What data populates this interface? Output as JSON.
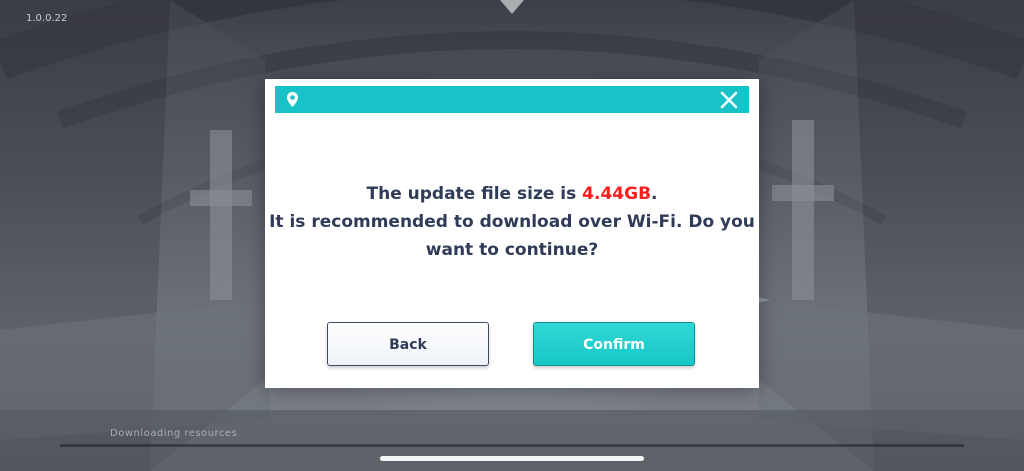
{
  "app": {
    "version": "1.0.0.22",
    "loading_label": "Downloading resources"
  },
  "dialog": {
    "title_icon": "location-pin-icon",
    "close_icon": "close-icon",
    "message_prefix": "The update file size is ",
    "file_size": "4.44GB",
    "message_suffix": ".",
    "message_line2": "It is recommended to download over Wi-Fi. Do you",
    "message_line3": "want to continue?",
    "back_label": "Back",
    "confirm_label": "Confirm"
  },
  "colors": {
    "accent": "#17c2c8",
    "size_highlight": "#ff1c1c",
    "text": "#2f3b57"
  }
}
